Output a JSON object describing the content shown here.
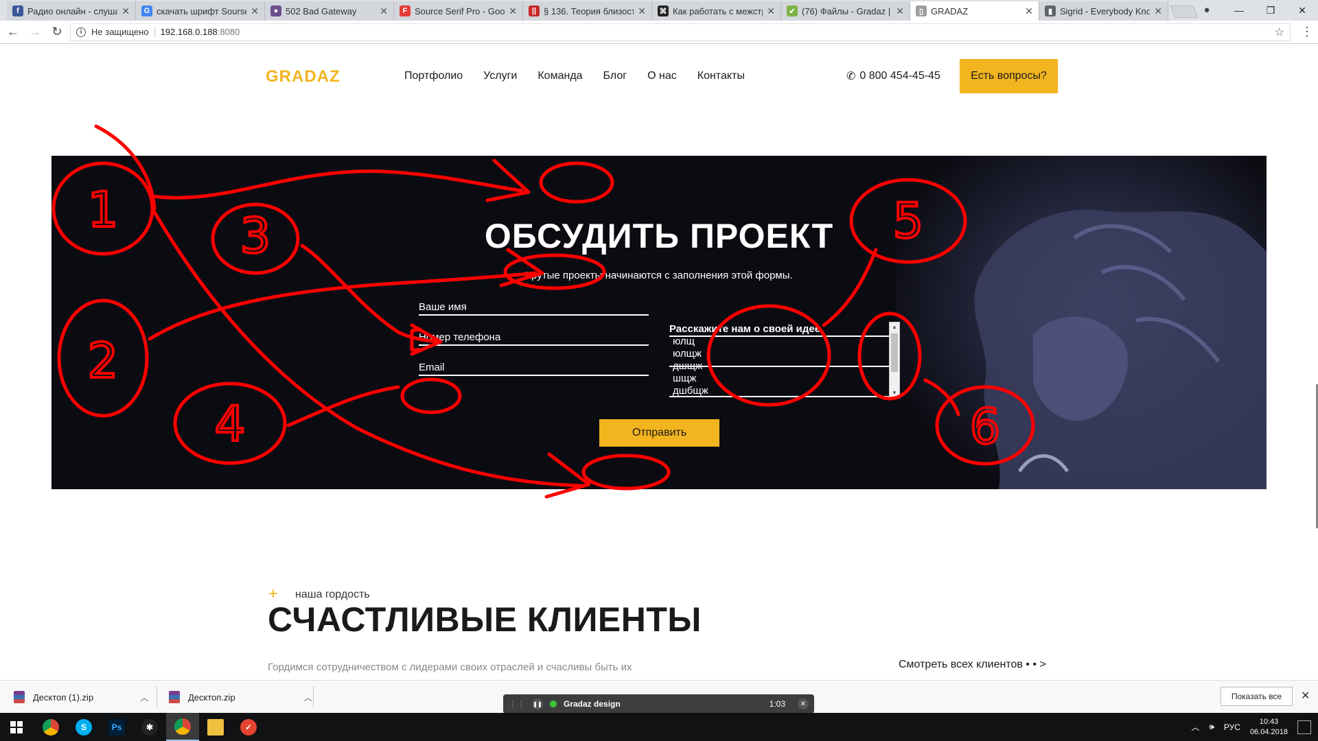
{
  "browser": {
    "tabs": [
      {
        "title": "Радио онлайн - слуша",
        "favicon_color": "#3b5998",
        "favicon_glyph": "f"
      },
      {
        "title": "скачать шрифт Sourse",
        "favicon_color": "#4285f4",
        "favicon_glyph": "G"
      },
      {
        "title": "502 Bad Gateway",
        "favicon_color": "#6b4f8f",
        "favicon_glyph": "●"
      },
      {
        "title": "Source Serif Pro - Goo",
        "favicon_color": "#e53935",
        "favicon_glyph": "F"
      },
      {
        "title": "§ 136. Теория близост",
        "favicon_color": "#c62828",
        "favicon_glyph": "||"
      },
      {
        "title": "Как работать с межстр",
        "favicon_color": "#222222",
        "favicon_glyph": "⌘"
      },
      {
        "title": "(76) Файлы - Gradaz | V",
        "favicon_color": "#7cb342",
        "favicon_glyph": "✔"
      },
      {
        "title": "GRADAZ",
        "favicon_color": "#9e9e9e",
        "favicon_glyph": "▯",
        "active": true
      },
      {
        "title": "Sigrid - Everybody Kno",
        "favicon_color": "#5f6368",
        "favicon_glyph": "▮"
      }
    ],
    "security_label": "Не защищено",
    "url_host": "192.168.0.188",
    "url_port": ":8080"
  },
  "site": {
    "logo": "GRADAZ",
    "nav": [
      "Портфолио",
      "Услуги",
      "Команда",
      "Блог",
      "О нас",
      "Контакты"
    ],
    "phone": "0 800 454-45-45",
    "cta": "Есть вопросы?"
  },
  "form": {
    "title": "ОБСУДИТЬ ПРОЕКТ",
    "subtitle": "Крутые проекты начинаются с заполнения этой формы.",
    "name_label": "Ваше имя",
    "phone_label": "Номер телефона",
    "email_label": "Email",
    "idea_label": "Расскажите нам о своей идее",
    "idea_lines": [
      "юлщ",
      "юлщж",
      "дшщж",
      "шщж",
      "дшбщж"
    ],
    "submit": "Отправить"
  },
  "annotations": {
    "color": "#ff0000",
    "numbers": [
      "1",
      "2",
      "3",
      "4",
      "5",
      "6"
    ]
  },
  "pride": {
    "label": "наша гордость",
    "title": "СЧАСТЛИВЫЕ КЛИЕНТЫ",
    "description": "Гордимся сотрудничеством с лидерами своих отраслей и счасливы быть их",
    "all_clients": "Смотреть всех клиентов • • >"
  },
  "downloads": {
    "items": [
      "Десктоп (1).zip",
      "Десктоп.zip"
    ],
    "show_all": "Показать все"
  },
  "media": {
    "title": "Gradaz design",
    "time": "1:03"
  },
  "taskbar": {
    "language": "РУС",
    "time": "10:43",
    "date": "06.04.2018"
  },
  "colors": {
    "accent": "#f2b41f",
    "banner_bg": "#0b0c12"
  }
}
